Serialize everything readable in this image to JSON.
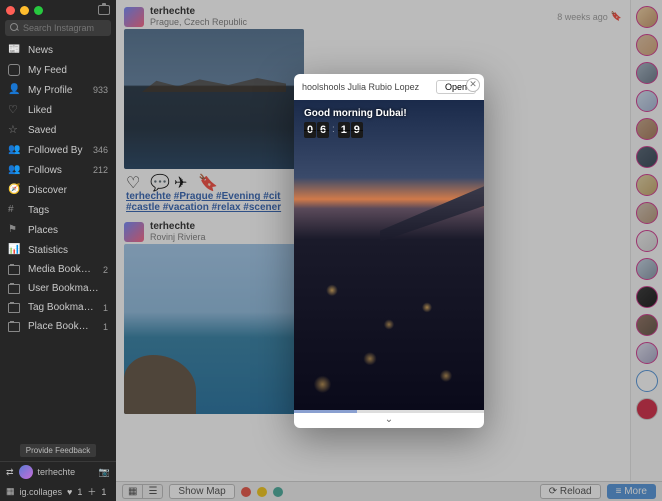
{
  "search": {
    "placeholder": "Search Instagram"
  },
  "nav": [
    {
      "label": "News",
      "count": ""
    },
    {
      "label": "My Feed",
      "count": ""
    },
    {
      "label": "My Profile",
      "count": "933"
    },
    {
      "label": "Liked",
      "count": ""
    },
    {
      "label": "Saved",
      "count": ""
    },
    {
      "label": "Followed By",
      "count": "346"
    },
    {
      "label": "Follows",
      "count": "212"
    },
    {
      "label": "Discover",
      "count": ""
    },
    {
      "label": "Tags",
      "count": ""
    },
    {
      "label": "Places",
      "count": ""
    },
    {
      "label": "Statistics",
      "count": ""
    },
    {
      "label": "Media Bookmarks",
      "count": "2"
    },
    {
      "label": "User Bookmarks",
      "count": ""
    },
    {
      "label": "Tag Bookmarks",
      "count": "1"
    },
    {
      "label": "Place Bookmarks",
      "count": "1"
    }
  ],
  "feedback_label": "Provide Feedback",
  "status": {
    "user": "terhechte",
    "collages": "ig.collages",
    "hearts": "1",
    "plus": "1"
  },
  "feed": {
    "post1": {
      "user": "terhechte",
      "location": "Prague, Czech Republic",
      "time": "8 weeks ago",
      "hashline1_user": "terhechte",
      "hashline1": "#Prague #Evening #cit",
      "hashline2": "#castle #vacation #relax #scener"
    },
    "post2": {
      "user": "terhechte",
      "location": "Rovinj Riviera"
    }
  },
  "toolbar": {
    "show_map": "Show Map",
    "reload": "Reload",
    "more": "More"
  },
  "modal": {
    "user": "hoolshools Julia Rubio Lopez",
    "open": "Open",
    "caption": "Good morning Dubai!",
    "clock": {
      "h1": "0",
      "h2": "6",
      "m1": "1",
      "m2": "9"
    },
    "progress_pct": 33
  }
}
